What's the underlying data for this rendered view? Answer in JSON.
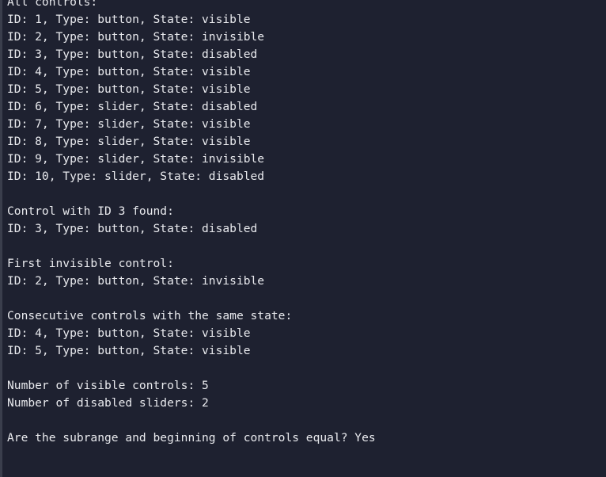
{
  "terminal": {
    "lines": [
      "All controls:",
      "ID: 1, Type: button, State: visible",
      "ID: 2, Type: button, State: invisible",
      "ID: 3, Type: button, State: disabled",
      "ID: 4, Type: button, State: visible",
      "ID: 5, Type: button, State: visible",
      "ID: 6, Type: slider, State: disabled",
      "ID: 7, Type: slider, State: visible",
      "ID: 8, Type: slider, State: visible",
      "ID: 9, Type: slider, State: invisible",
      "ID: 10, Type: slider, State: disabled",
      "",
      "Control with ID 3 found:",
      "ID: 3, Type: button, State: disabled",
      "",
      "First invisible control:",
      "ID: 2, Type: button, State: invisible",
      "",
      "Consecutive controls with the same state:",
      "ID: 4, Type: button, State: visible",
      "ID: 5, Type: button, State: visible",
      "",
      "Number of visible controls: 5",
      "Number of disabled sliders: 2",
      "",
      "Are the subrange and beginning of controls equal? Yes"
    ]
  }
}
